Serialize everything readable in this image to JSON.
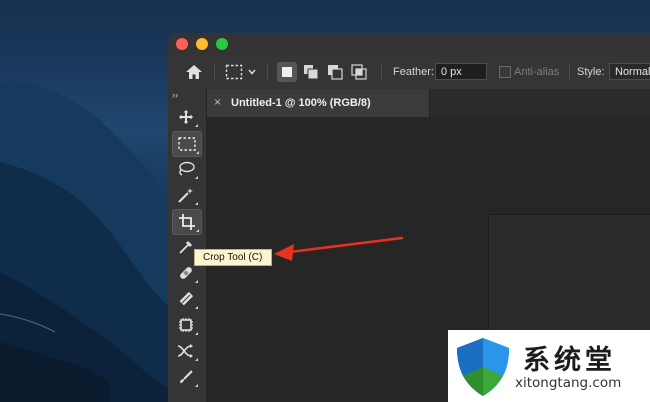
{
  "options": {
    "feather_label": "Feather:",
    "feather_value": "0 px",
    "antialias_label": "Anti-alias",
    "style_label": "Style:",
    "style_value": "Normal"
  },
  "document": {
    "tab_title": "Untitled-1 @ 100% (RGB/8)",
    "tab_close": "×"
  },
  "toolbar": {
    "collapse_glyph": "››",
    "tools": [
      {
        "name": "move-tool"
      },
      {
        "name": "rectangular-marquee-tool",
        "active": true
      },
      {
        "name": "lasso-tool"
      },
      {
        "name": "magic-wand-tool"
      },
      {
        "name": "crop-tool",
        "active": true
      },
      {
        "name": "eyedropper-tool"
      },
      {
        "name": "healing-brush-tool"
      },
      {
        "name": "brush-tool"
      },
      {
        "name": "clone-stamp-tool"
      },
      {
        "name": "history-brush-tool"
      },
      {
        "name": "pen-brush-tool"
      }
    ]
  },
  "tooltip": {
    "text": "Crop Tool (C)"
  },
  "watermark": {
    "title": "系统堂",
    "url": "xitongtang.com"
  },
  "colors": {
    "close": "#ff5f57",
    "minimize": "#febc2e",
    "zoom": "#28c840",
    "arrow": "#e8321f",
    "shield_blue": "#1e7fd8",
    "shield_green": "#3aa93a"
  }
}
